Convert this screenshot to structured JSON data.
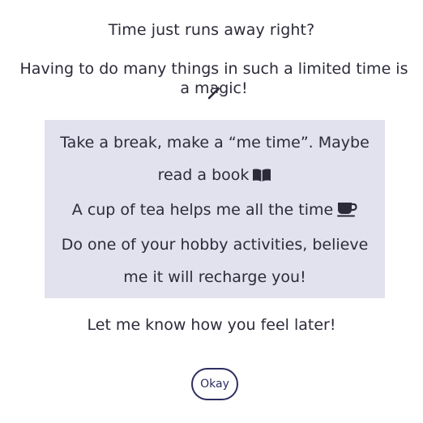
{
  "dialog": {
    "title": "Time just runs away right?",
    "subtitle": "Having to do many things in such a limited time is a magic!",
    "subtitle_icon": "magic-wand-icon",
    "panel": {
      "line1": "Take a break, make a “me time”. Maybe read a book",
      "line1_icon": "book-icon",
      "line2": "A cup of tea helps me all the time",
      "line2_icon": "coffee-cup-icon",
      "line3": "Do one of your hobby activities, believe me it will recharge you!"
    },
    "footer": "Let me know how you feel later!",
    "okay_label": "Okay"
  },
  "colors": {
    "panel_background": "#e2e1ee",
    "text": "#2b2b3a",
    "button_border": "#2e2d62",
    "page_background": "#ffffff"
  }
}
